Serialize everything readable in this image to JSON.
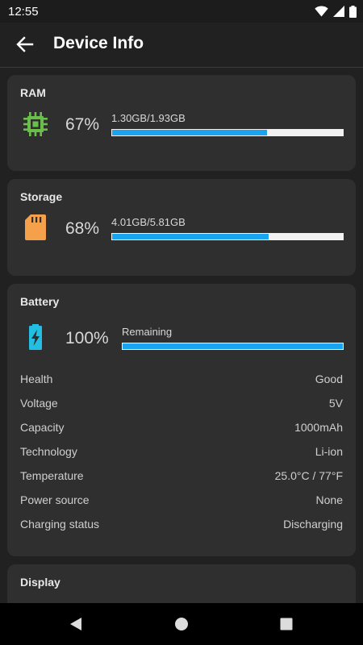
{
  "status_bar": {
    "time": "12:55",
    "icons": [
      "wifi-icon",
      "cellular-signal-icon",
      "battery-icon"
    ]
  },
  "app_bar": {
    "back_icon": "arrow-back-icon",
    "title": "Device Info"
  },
  "ram": {
    "title": "RAM",
    "icon": "chip-icon",
    "percent": "67%",
    "usage": "1.30GB/1.93GB",
    "fill_fraction": 0.67,
    "color": "#6abf4b"
  },
  "storage": {
    "title": "Storage",
    "icon": "sd-card-icon",
    "percent": "68%",
    "usage": "4.01GB/5.81GB",
    "fill_fraction": 0.68,
    "color": "#f5a04a"
  },
  "battery": {
    "title": "Battery",
    "icon": "battery-charging-icon",
    "percent": "100%",
    "usage": "Remaining",
    "fill_fraction": 1.0,
    "color": "#22bfe3",
    "details": [
      {
        "label": "Health",
        "value": "Good"
      },
      {
        "label": "Voltage",
        "value": "5V"
      },
      {
        "label": "Capacity",
        "value": "1000mAh"
      },
      {
        "label": "Technology",
        "value": "Li-ion"
      },
      {
        "label": "Temperature",
        "value": "25.0°C / 77°F"
      },
      {
        "label": "Power source",
        "value": "None"
      },
      {
        "label": "Charging status",
        "value": "Discharging"
      }
    ]
  },
  "display": {
    "title": "Display"
  },
  "accent_color": "#1aa3ee",
  "nav_bar": {
    "buttons": [
      "back-triangle-icon",
      "home-circle-icon",
      "recents-square-icon"
    ]
  }
}
